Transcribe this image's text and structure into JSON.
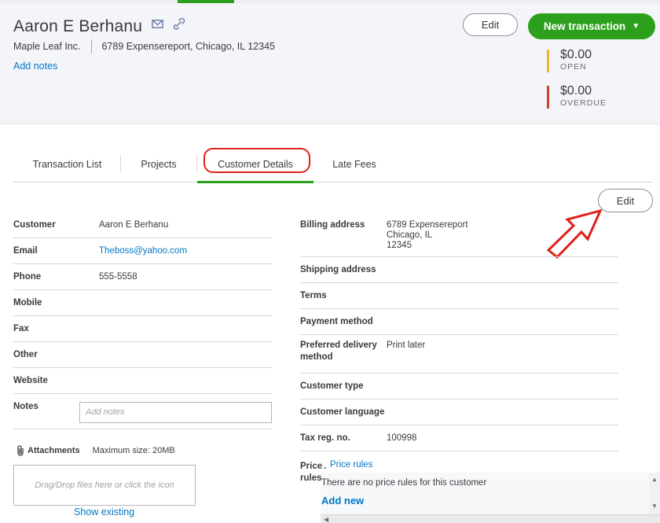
{
  "customer": {
    "name": "Aaron E Berhanu",
    "company": "Maple Leaf Inc.",
    "address_line": "6789 Expensereport, Chicago, IL 12345",
    "add_notes": "Add notes"
  },
  "header_actions": {
    "edit_label": "Edit",
    "new_transaction_label": "New transaction"
  },
  "balances": [
    {
      "amount": "$0.00",
      "label": "OPEN",
      "color": "#f2b62b"
    },
    {
      "amount": "$0.00",
      "label": "OVERDUE",
      "color": "#c9432e"
    }
  ],
  "tabs": [
    {
      "label": "Transaction List"
    },
    {
      "label": "Projects"
    },
    {
      "label": "Customer Details"
    },
    {
      "label": "Late Fees"
    }
  ],
  "details_edit_label": "Edit",
  "left_fields": [
    {
      "label": "Customer",
      "value": "Aaron E Berhanu"
    },
    {
      "label": "Email",
      "value": "Theboss@yahoo.com"
    },
    {
      "label": "Phone",
      "value": "555-5558"
    },
    {
      "label": "Mobile",
      "value": ""
    },
    {
      "label": "Fax",
      "value": ""
    },
    {
      "label": "Other",
      "value": ""
    },
    {
      "label": "Website",
      "value": ""
    },
    {
      "label": "Notes",
      "value": ""
    }
  ],
  "notes_placeholder": "Add notes",
  "attachments": {
    "label": "Attachments",
    "max_size": "Maximum size: 20MB",
    "dropzone": "Drag/Drop files here or click the icon",
    "show_existing": "Show existing"
  },
  "right_fields": {
    "billing_label": "Billing address",
    "billing_line1": "6789 Expensereport",
    "billing_line2": "Chicago, IL",
    "billing_line3": "12345",
    "shipping_label": "Shipping address",
    "terms_label": "Terms",
    "payment_label": "Payment method",
    "pref_delivery_label": "Preferred delivery method",
    "pref_delivery_value": "Print later",
    "customer_type_label": "Customer type",
    "customer_language_label": "Customer language",
    "tax_reg_label": "Tax reg. no.",
    "tax_reg_value": "100998"
  },
  "price_rules": {
    "label_line1": "Price",
    "label_line2": "rules",
    "link": "Price rules",
    "message": "There are no price rules for this customer",
    "add_new": "Add new"
  },
  "colors": {
    "accent_green": "#2ca01c",
    "link_blue": "#0077c5",
    "annotation_red": "#e0201a"
  }
}
